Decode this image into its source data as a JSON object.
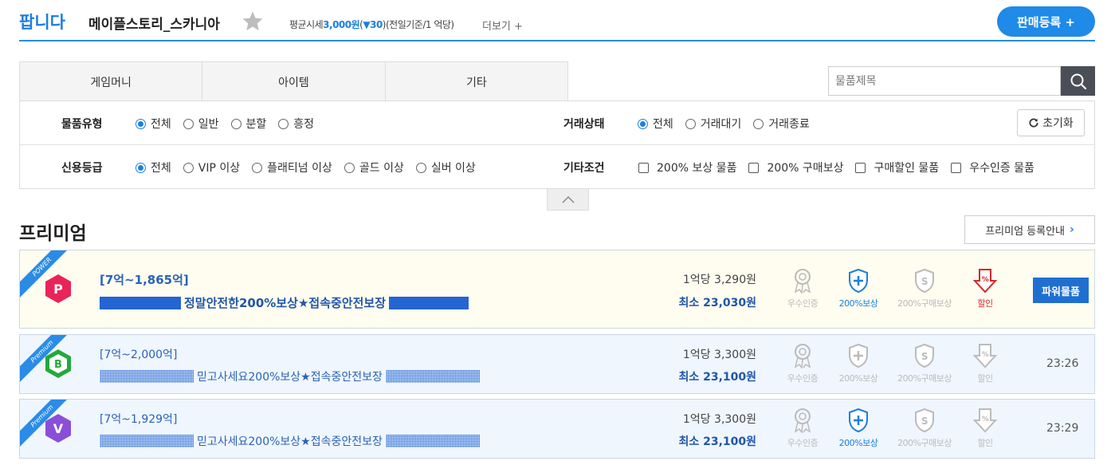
{
  "header": {
    "logo": "팝니다",
    "server_name": "메이플스토리_스카니아",
    "avg_label": "평균시세",
    "avg_price": "3,000원",
    "avg_change_open": "(",
    "avg_change": "▼30",
    "avg_change_close": ")",
    "avg_note": "(전일기준/1 억당)",
    "more_label": "더보기 +",
    "sell_button": "판매등록 +"
  },
  "tabs": [
    {
      "label": "게임머니"
    },
    {
      "label": "아이템"
    },
    {
      "label": "기타"
    }
  ],
  "search": {
    "placeholder": "물품제목"
  },
  "filters": {
    "item_type": {
      "label": "물품유형",
      "options": [
        "전체",
        "일반",
        "분할",
        "흥정"
      ],
      "selected": "전체"
    },
    "trade_status": {
      "label": "거래상태",
      "options": [
        "전체",
        "거래대기",
        "거래종료"
      ],
      "selected": "전체"
    },
    "credit_grade": {
      "label": "신용등급",
      "options": [
        "전체",
        "VIP 이상",
        "플래티넘 이상",
        "골드 이상",
        "실버 이상"
      ],
      "selected": "전체"
    },
    "other": {
      "label": "기타조건",
      "options": [
        "200% 보상 물품",
        "200% 구매보상",
        "구매할인 물품",
        "우수인증 물품"
      ]
    },
    "reset_label": "초기화"
  },
  "premium": {
    "title": "프리미엄",
    "guide_label": "프리미엄 등록안내"
  },
  "listings": [
    {
      "ribbon": "POWER",
      "badge_letter": "P",
      "range": "[7억~1,865억]",
      "title": "정말안전한200%보상★접속중안전보장",
      "price_per": "1억당 3,290원",
      "min_price": "최소 23,030원",
      "icons": [
        "우수인증",
        "200%보상",
        "200%구매보상",
        "할인"
      ],
      "action_label": "파워물품"
    },
    {
      "ribbon": "Premium",
      "badge_letter": "B",
      "range": "[7억~2,000억]",
      "title": "믿고사세요200%보상★접속중안전보장",
      "price_per": "1억당 3,300원",
      "min_price": "최소 23,100원",
      "icons": [
        "우수인증",
        "200%보상",
        "200%구매보상",
        "할인"
      ],
      "time": "23:26"
    },
    {
      "ribbon": "Premium",
      "badge_letter": "V",
      "range": "[7억~1,929억]",
      "title": "믿고사세요200%보상★접속중안전보장",
      "price_per": "1억당 3,300원",
      "min_price": "최소 23,100원",
      "icons": [
        "우수인증",
        "200%보상",
        "200%구매보상",
        "할인"
      ],
      "time": "23:29"
    }
  ],
  "colors": {
    "accent": "#1c7fe0",
    "power_bg": "#fefdf0",
    "premium_bg": "#eff6fd",
    "discount_red": "#d62828"
  }
}
